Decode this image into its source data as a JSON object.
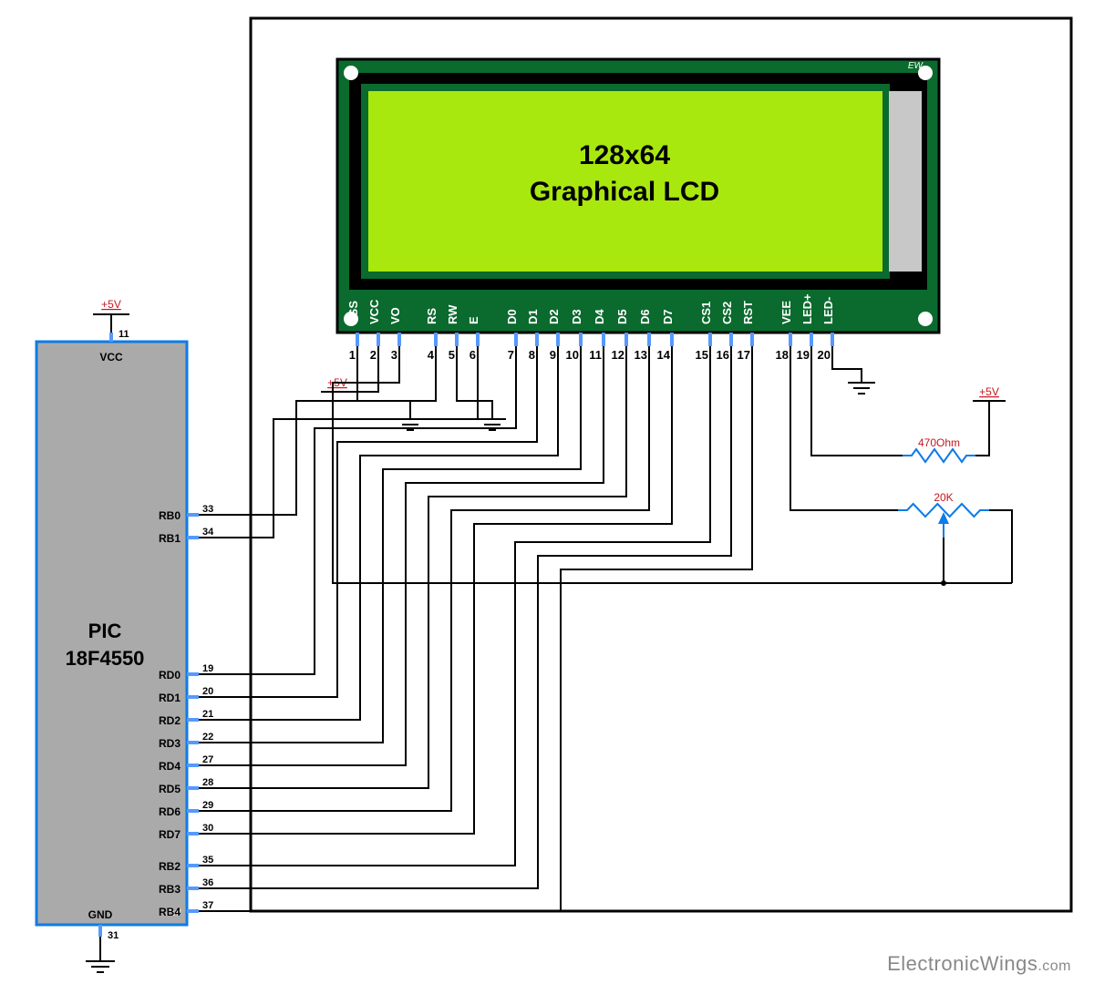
{
  "mcu": {
    "name_l1": "PIC",
    "name_l2": "18F4550",
    "vcc_label": "VCC",
    "gnd_label": "GND",
    "vcc_pin": "11",
    "gnd_pin": "31",
    "ew": "EW",
    "pins_rb01": [
      {
        "name": "RB0",
        "num": "33"
      },
      {
        "name": "RB1",
        "num": "34"
      }
    ],
    "pins_rd": [
      {
        "name": "RD0",
        "num": "19"
      },
      {
        "name": "RD1",
        "num": "20"
      },
      {
        "name": "RD2",
        "num": "21"
      },
      {
        "name": "RD3",
        "num": "22"
      },
      {
        "name": "RD4",
        "num": "27"
      },
      {
        "name": "RD5",
        "num": "28"
      },
      {
        "name": "RD6",
        "num": "29"
      },
      {
        "name": "RD7",
        "num": "30"
      }
    ],
    "pins_rb234": [
      {
        "name": "RB2",
        "num": "35"
      },
      {
        "name": "RB3",
        "num": "36"
      },
      {
        "name": "RB4",
        "num": "37"
      }
    ]
  },
  "vrail": {
    "label": "+5V"
  },
  "lcd": {
    "title_l1": "128x64",
    "title_l2": "Graphical LCD",
    "ew": "EW",
    "pins": [
      {
        "name": "VSS",
        "num": "1"
      },
      {
        "name": "VCC",
        "num": "2"
      },
      {
        "name": "VO",
        "num": "3"
      },
      {
        "name": "RS",
        "num": "4"
      },
      {
        "name": "RW",
        "num": "5"
      },
      {
        "name": "E",
        "num": "6"
      },
      {
        "name": "D0",
        "num": "7"
      },
      {
        "name": "D1",
        "num": "8"
      },
      {
        "name": "D2",
        "num": "9"
      },
      {
        "name": "D3",
        "num": "10"
      },
      {
        "name": "D4",
        "num": "11"
      },
      {
        "name": "D5",
        "num": "12"
      },
      {
        "name": "D6",
        "num": "13"
      },
      {
        "name": "D7",
        "num": "14"
      },
      {
        "name": "CS1",
        "num": "15"
      },
      {
        "name": "CS2",
        "num": "16"
      },
      {
        "name": "RST",
        "num": "17"
      },
      {
        "name": "VEE",
        "num": "18"
      },
      {
        "name": "LED+",
        "num": "19"
      },
      {
        "name": "LED-",
        "num": "20"
      }
    ]
  },
  "components": {
    "r1": "470Ohm",
    "r2": "20K"
  },
  "footer": {
    "a": "ElectronicWings",
    "b": ".com"
  }
}
